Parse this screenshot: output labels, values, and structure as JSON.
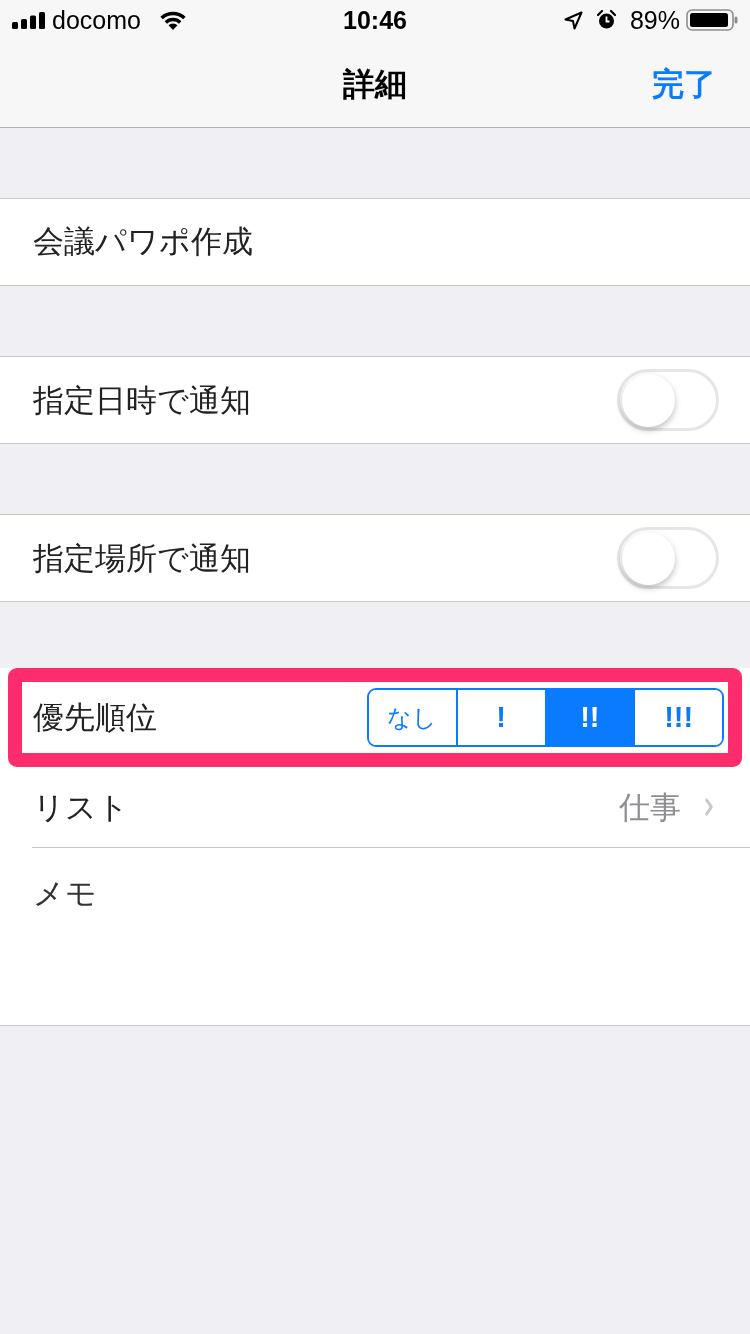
{
  "status_bar": {
    "carrier": "docomo",
    "time": "10:46",
    "battery": "89%"
  },
  "nav_bar": {
    "title": "詳細",
    "done_button": "完了"
  },
  "title_field": {
    "value": "会議パワポ作成"
  },
  "toggles": [
    {
      "label": "指定日時で通知",
      "on": false
    },
    {
      "label": "指定場所で通知",
      "on": false
    }
  ],
  "priority": {
    "label": "優先順位",
    "highlighted": true,
    "options": [
      {
        "label": "なし",
        "selected": false
      },
      {
        "label": "!",
        "selected": false
      },
      {
        "label": "!!",
        "selected": true
      },
      {
        "label": "!!!",
        "selected": false
      }
    ]
  },
  "list": {
    "label": "リスト",
    "value": "仕事"
  },
  "memo": {
    "placeholder": "メモ"
  }
}
